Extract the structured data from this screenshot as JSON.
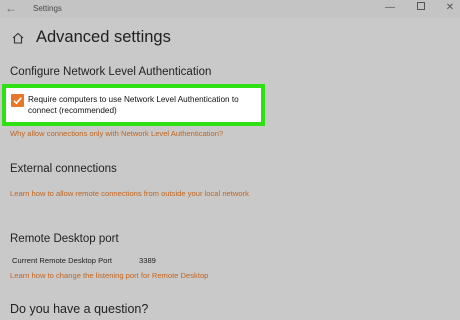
{
  "window": {
    "title": "Settings",
    "back_glyph": "←",
    "minimize_glyph": "—",
    "close_glyph": "✕"
  },
  "page": {
    "title": "Advanced settings"
  },
  "nla": {
    "heading": "Configure Network Level Authentication",
    "checkbox_label": "Require computers to use Network Level Authentication to connect (recommended)",
    "checkbox_checked": true,
    "link": "Why allow connections only with Network Level Authentication?"
  },
  "external": {
    "heading": "External connections",
    "link": "Learn how to allow remote connections from outside your local network"
  },
  "rdp_port": {
    "heading": "Remote Desktop port",
    "label": "Current Remote Desktop Port",
    "value": "3389",
    "link": "Learn how to change the listening port for Remote Desktop"
  },
  "question": {
    "heading": "Do you have a question?"
  },
  "colors": {
    "accent": "#c2651e",
    "checkbox": "#e8772a",
    "highlight": "#2fe014",
    "background": "#c9c9c9"
  },
  "icons": {
    "back": "back-arrow-icon",
    "home": "home-icon",
    "check": "checkmark-icon"
  }
}
